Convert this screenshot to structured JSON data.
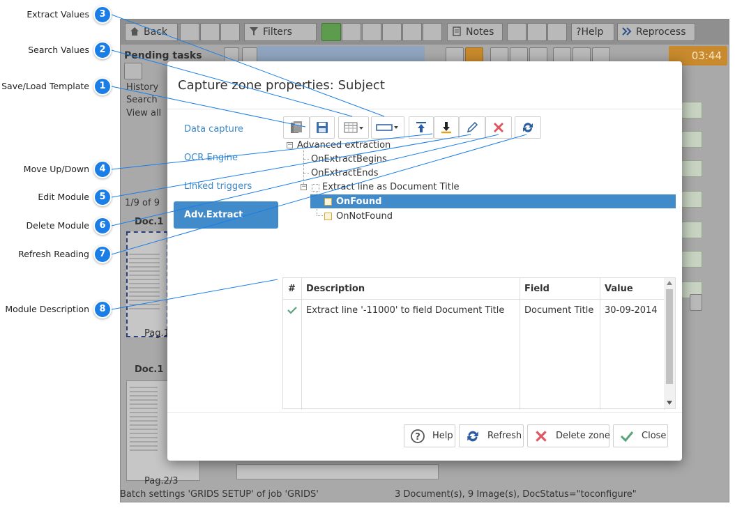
{
  "app": {
    "toolbar": {
      "back": "Back",
      "filters": "Filters",
      "notes": "Notes",
      "help": "Help",
      "reprocess": "Reprocess"
    },
    "timer": "03:44",
    "pending_tasks": "Pending tasks",
    "menu": [
      "History",
      "Search",
      "View all"
    ],
    "page_counter": "1/9 of 9",
    "docs": [
      {
        "label": "Doc.1",
        "page": "Pag.1"
      },
      {
        "label": "Doc.1",
        "page": "Pag.2/3"
      }
    ],
    "status_left": "Batch settings 'GRIDS SETUP' of job 'GRIDS'",
    "status_right": "3 Document(s), 9 Image(s), DocStatus=\"toconfigure\"",
    "accent_green": "#5c9c4c",
    "accent_orange": "#c88a2c"
  },
  "modal": {
    "title": "Capture zone properties: Subject",
    "nav": [
      {
        "label": "Data capture",
        "active": false
      },
      {
        "label": "OCR Engine",
        "active": false
      },
      {
        "label": "Linked triggers",
        "active": false
      },
      {
        "label": "Adv.Extract",
        "active": true
      }
    ],
    "toolbar_icons": [
      "save-load-template-icon",
      "save-icon",
      "search-values-icon",
      "extract-values-icon",
      "move-up-icon",
      "move-down-icon",
      "edit-icon",
      "delete-icon",
      "refresh-icon"
    ],
    "tree": {
      "root": "Advanced extraction",
      "children": [
        "OnExtractBegins",
        "OnExtractEnds"
      ],
      "module": "Extract line as Document Title",
      "module_children": [
        {
          "label": "OnFound",
          "selected": true
        },
        {
          "label": "OnNotFound",
          "selected": false
        }
      ]
    },
    "grid": {
      "columns": [
        "#",
        "Description",
        "Field",
        "Value"
      ],
      "rows": [
        {
          "status": "check",
          "description": "Extract line '-11000' to field Document Title",
          "field": "Document Title",
          "value": "30-09-2014"
        }
      ]
    },
    "footer": {
      "help": "Help",
      "refresh": "Refresh",
      "delete": "Delete zone",
      "close": "Close"
    },
    "accent": "#428bca"
  },
  "callouts": [
    {
      "n": "3",
      "label": "Extract Values"
    },
    {
      "n": "2",
      "label": "Search Values"
    },
    {
      "n": "1",
      "label": "Save/Load Template"
    },
    {
      "n": "4",
      "label": "Move Up/Down"
    },
    {
      "n": "5",
      "label": "Edit Module"
    },
    {
      "n": "6",
      "label": "Delete Module"
    },
    {
      "n": "7",
      "label": "Refresh Reading"
    },
    {
      "n": "8",
      "label": "Module Description"
    }
  ],
  "callout_color": "#1a7ee6"
}
